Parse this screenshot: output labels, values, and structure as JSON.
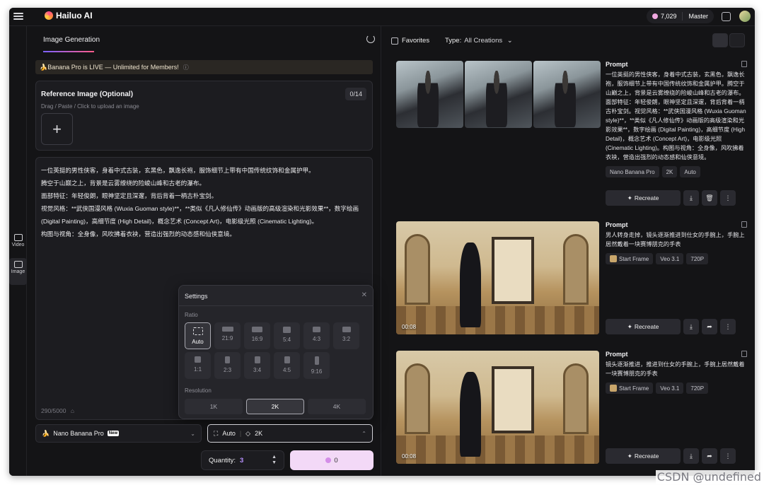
{
  "app": {
    "name": "Hailuo AI",
    "credits": "7,029",
    "plan": "Master"
  },
  "sidebar": {
    "items": [
      {
        "label": "Video"
      },
      {
        "label": "Image"
      }
    ]
  },
  "left": {
    "tab": "Image Generation",
    "banner": "🍌Banana Pro is LIVE — Unlimited for Members!",
    "reference": {
      "title": "Reference Image (Optional)",
      "subtitle": "Drag / Paste / Click to upload an image",
      "count": "0/14",
      "add_label": "+"
    },
    "prompt": "一位英挺的男性侠客，身着中式古装，玄黑色，飘逸长袍，服饰细节上带有中国传统纹饰和金属护甲。\n腾空于山巅之上，背景是云雾缭绕的险峻山峰和古老的瀑布。\n面部特征：年轻俊朗，眼神坚定且深邃，背后背着一柄古朴宝剑。\n视觉风格：**武侠国漫风格 (Wuxia Guoman style)**，**类似《凡人修仙传》动画版的高级渲染和光影效果**，数字绘画 (Digital Painting)，高细节度 (High Detail)，概念艺术 (Concept Art)，电影级光照 (Cinematic Lighting)。\n构图与视角：全身像，风吹拂着衣袂，营造出强烈的动态感和仙侠意境。",
    "char_count": "290/5000",
    "settings": {
      "title": "Settings",
      "ratio_label": "Ratio",
      "resolution_label": "Resolution",
      "ratios": [
        "Auto",
        "21:9",
        "16:9",
        "5:4",
        "4:3",
        "3:2",
        "1:1",
        "2:3",
        "3:4",
        "4:5",
        "9:16"
      ],
      "selected_ratio": "Auto",
      "resolutions": [
        "1K",
        "2K",
        "4K"
      ],
      "selected_resolution": "2K"
    },
    "model": {
      "name": "Nano Banana Pro",
      "badge": "New"
    },
    "params": {
      "ratio": "Auto",
      "resolution": "2K"
    },
    "quantity": {
      "label": "Quantity:",
      "value": "3"
    },
    "generate": {
      "cost": "0"
    }
  },
  "right": {
    "favorites_label": "Favorites",
    "type_label": "Type:",
    "type_value": "All Creations",
    "items": [
      {
        "heading": "Prompt",
        "text": "一位英挺的男性侠客，身着中式古装，玄黑色，飘逸长袍，服饰细节上带有中国传统纹饰和金属护甲。腾空于山巅之上，背景是云雾缭绕的险峻山峰和古老的瀑布。面部特征：年轻俊朗，眼神坚定且深邃，背后背着一柄古朴宝剑。视觉风格：**武侠国漫风格 (Wuxia Guoman style)**，**类似《凡人修仙传》动画版的高级渲染和光影效果**，数字绘画 (Digital Painting)，高细节度 (High Detail)，概念艺术 (Concept Art)，电影级光照 (Cinematic Lighting)。构图与视角：全身像，风吹拂着衣袂，营造出强烈的动态感和仙侠意境。",
        "tags": [
          "Nano Banana Pro",
          "2K",
          "Auto"
        ],
        "action": "Recreate"
      },
      {
        "heading": "Prompt",
        "text": "男人转身走掉，镜头逐渐推进到仕女的手腕上，手腕上居然戴着一块赛博朋克的手表",
        "tags": [
          "Start Frame",
          "Veo 3.1",
          "720P"
        ],
        "duration": "00:08",
        "action": "Recreate"
      },
      {
        "heading": "Prompt",
        "text": "镜头逐渐推进，推进到仕女的手腕上，手腕上居然戴着一块赛博朋克的手表",
        "tags": [
          "Start Frame",
          "Veo 3.1",
          "720P"
        ],
        "duration": "00:08",
        "action": "Recreate"
      }
    ]
  },
  "watermark": "CSDN @undefined"
}
